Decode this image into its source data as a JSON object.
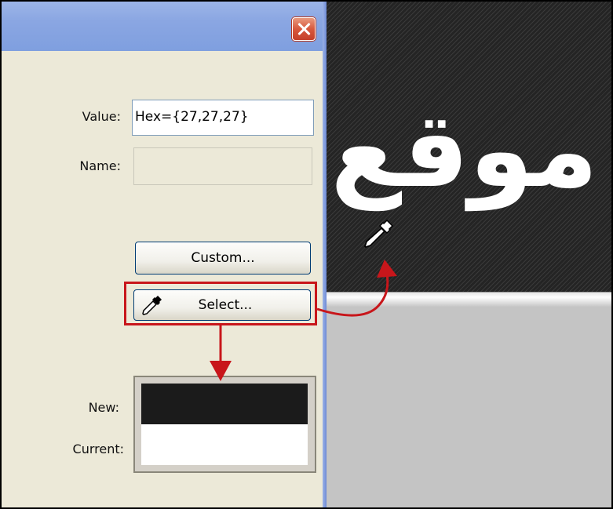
{
  "dialog": {
    "value_label": "Value:",
    "value_text": "Hex={27,27,27}",
    "name_label": "Name:",
    "name_text": "",
    "custom_button": "Custom...",
    "select_button": "Select...",
    "new_label": "New:",
    "current_label": "Current:",
    "new_color": "#1b1b1b",
    "current_color": "#ffffff"
  },
  "canvas": {
    "arabic_text": "موقع"
  },
  "colors": {
    "highlight": "#c8161b",
    "titlebar": "#8aa6e2",
    "dialog_bg": "#ece9d8"
  },
  "icons": {
    "close": "close-icon",
    "dropper": "eyedropper-icon"
  }
}
